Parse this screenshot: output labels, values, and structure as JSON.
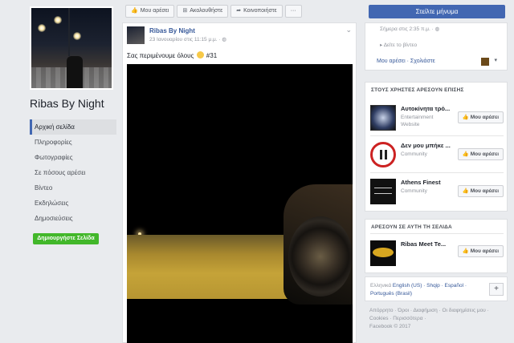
{
  "page": {
    "name": "Ribas By Night"
  },
  "left_nav": {
    "items": [
      {
        "label": "Αρχική σελίδα",
        "active": true
      },
      {
        "label": "Πληροφορίες",
        "active": false
      },
      {
        "label": "Φωτογραφίες",
        "active": false
      },
      {
        "label": "Σε πόσους αρέσει",
        "active": false
      },
      {
        "label": "Βίντεο",
        "active": false
      },
      {
        "label": "Εκδηλώσεις",
        "active": false
      },
      {
        "label": "Δημοσιεύσεις",
        "active": false
      }
    ],
    "create_page": "Δημιουργήστε Σελίδα"
  },
  "actionbar": {
    "like": "Μου αρέσει",
    "follow": "Ακολουθήστε",
    "share": "Κοινοποιήστε",
    "more": "···",
    "send_message": "Στείλτε μήνυμα"
  },
  "post": {
    "author": "Ribas By Night",
    "time": "23 Ιανουαρίου στις 11:15 μ.μ. · ",
    "text_before": "Σας περιμένουμε όλους",
    "text_after": "#31"
  },
  "right_top": {
    "time": "Σήμερα στις 2:35 π.μ. · ",
    "video_link": "Δείτε το βίντεο",
    "like": "Μου αρέσει",
    "comment": "Σχολιάστε"
  },
  "suggestions": {
    "heading": "ΣΤΟΥΣ ΧΡΗΣΤΕΣ ΑΡΕΣΟΥΝ ΕΠΙΣΗΣ",
    "items": [
      {
        "name": "Αυτοκίνητα τρό...",
        "category": "Entertainment Website",
        "button": "Μου αρέσει"
      },
      {
        "name": "Δεν μου μπήκε ...",
        "category": "Community",
        "button": "Μου αρέσει"
      },
      {
        "name": "Athens Finest",
        "category": "Community",
        "button": "Μου αρέσει"
      }
    ]
  },
  "liked_by_page": {
    "heading": "ΑΡΕΣΟΥΝ ΣΕ ΑΥΤΗ ΤΗ ΣΕΛΙΔΑ",
    "items": [
      {
        "name": "Ribas Meet Te...",
        "button": "Μου αρέσει"
      }
    ]
  },
  "languages": {
    "current": "Ελληνικά",
    "others": "English (US) · Shqip · Español · Português (Brasil)",
    "more": "+"
  },
  "footer": {
    "links": "Απόρρητο · Όροι · Διαφήμιση · Οι διαφημίσεις μου · Cookies · Περισσότερα ·",
    "copyright": "Facebook © 2017"
  }
}
